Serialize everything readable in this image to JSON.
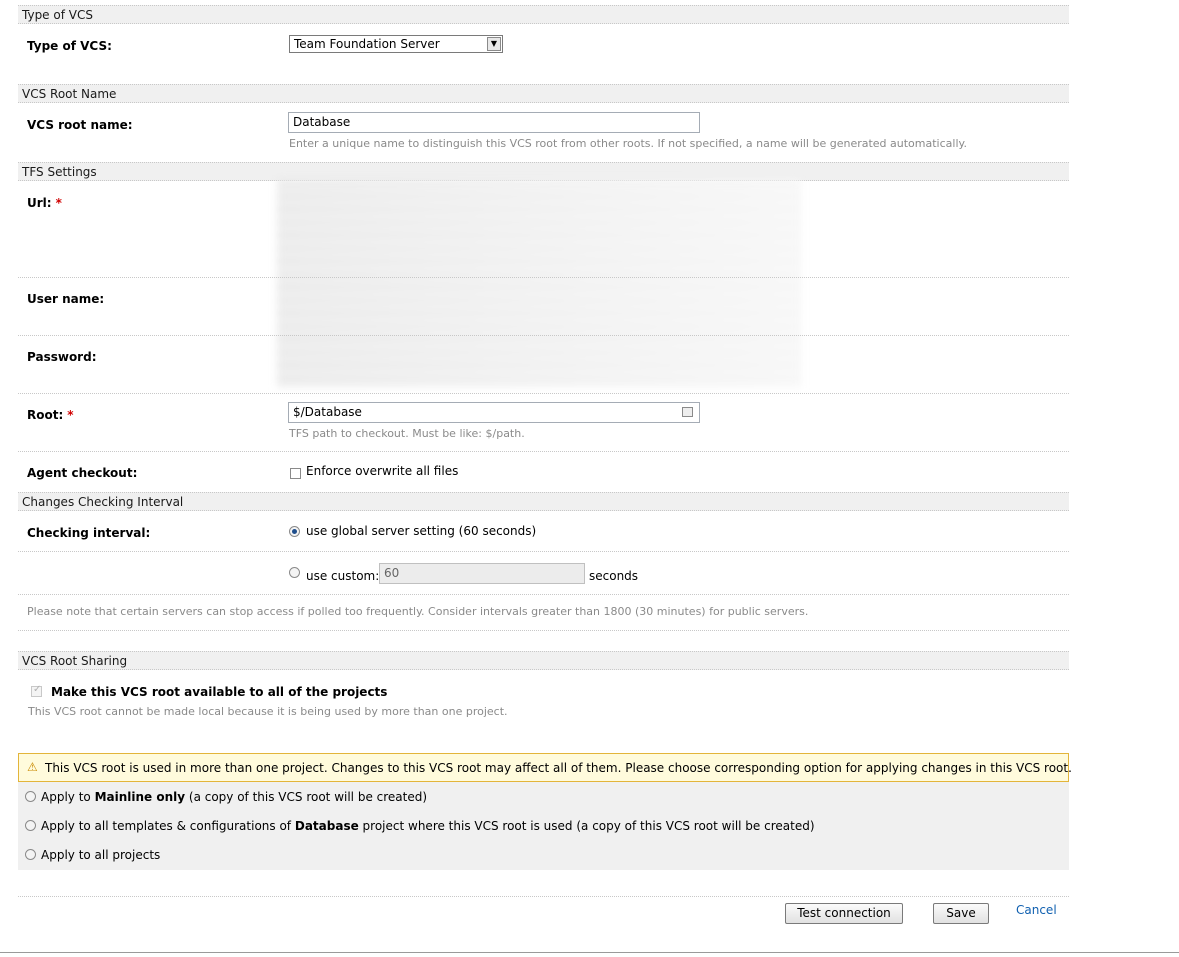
{
  "sections": {
    "type_of_vcs": "Type of VCS",
    "vcs_root_name": "VCS Root Name",
    "tfs_settings": "TFS Settings",
    "changes_checking_interval": "Changes Checking Interval",
    "vcs_root_sharing": "VCS Root Sharing"
  },
  "type_of_vcs": {
    "label": "Type of VCS:",
    "selected": "Team Foundation Server"
  },
  "vcs_root_name": {
    "label": "VCS root name:",
    "value": "Database",
    "hint": "Enter a unique name to distinguish this VCS root from other roots. If not specified, a name will be generated automatically."
  },
  "tfs": {
    "url_label": "Url:",
    "required_mark": "*",
    "username_label": "User name:",
    "password_label": "Password:",
    "root_label": "Root:",
    "root_value": "$/Database",
    "root_hint": "TFS path to checkout. Must be like: $/path.",
    "agent_checkout_label": "Agent checkout:",
    "enforce_overwrite": "Enforce overwrite all files"
  },
  "interval": {
    "label": "Checking interval:",
    "global_option": "use global server setting (60 seconds)",
    "custom_option": "use custom:",
    "custom_value": "60",
    "unit": "seconds",
    "note": "Please note that certain servers can stop access if polled too frequently. Consider intervals greater than 1800 (30 minutes) for public servers."
  },
  "sharing": {
    "checkbox_label": "Make this VCS root available to all of the projects",
    "hint": "This VCS root cannot be made local because it is being used by more than one project."
  },
  "warning": {
    "text": "This VCS root is used in more than one project. Changes to this VCS root may affect all of them. Please choose corresponding option for applying changes in this VCS root."
  },
  "apply_options": {
    "opt1_pre": "Apply to ",
    "opt1_bold": "Mainline only",
    "opt1_post": " (a copy of this VCS root will be created)",
    "opt2_pre": "Apply to all templates & configurations of ",
    "opt2_bold": "Database",
    "opt2_post": " project where this VCS root is used (a copy of this VCS root will be created)",
    "opt3": "Apply to all projects"
  },
  "buttons": {
    "test_connection": "Test connection",
    "save": "Save",
    "cancel": "Cancel"
  }
}
